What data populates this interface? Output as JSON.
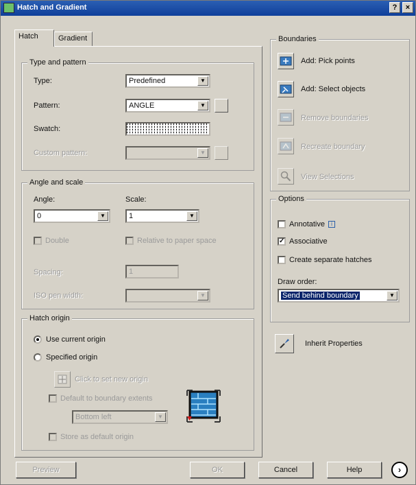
{
  "window": {
    "title": "Hatch and Gradient",
    "help_glyph": "?",
    "close_glyph": "×"
  },
  "tabs": [
    {
      "label": "Hatch"
    },
    {
      "label": "Gradient"
    }
  ],
  "type_pattern": {
    "group_label": "Type and pattern",
    "type_label": "Type:",
    "type_value": "Predefined",
    "pattern_label": "Pattern:",
    "pattern_value": "ANGLE",
    "swatch_label": "Swatch:",
    "custom_label": "Custom pattern:"
  },
  "angle_scale": {
    "group_label": "Angle and scale",
    "angle_label": "Angle:",
    "angle_value": "0",
    "scale_label": "Scale:",
    "scale_value": "1",
    "double_label": "Double",
    "relative_label": "Relative to paper space",
    "spacing_label": "Spacing:",
    "spacing_value": "1",
    "iso_label": "ISO pen width:"
  },
  "origin": {
    "group_label": "Hatch origin",
    "use_current": "Use current origin",
    "specified": "Specified origin",
    "click_set": "Click to set new origin",
    "default_extents": "Default to boundary extents",
    "position_value": "Bottom left",
    "store_default": "Store as default origin"
  },
  "boundaries": {
    "group_label": "Boundaries",
    "add_pick": "Add: Pick points",
    "add_select": "Add: Select objects",
    "remove": "Remove boundaries",
    "recreate": "Recreate boundary",
    "view": "View Selections"
  },
  "options": {
    "group_label": "Options",
    "annotative": "Annotative",
    "associative": "Associative",
    "separate": "Create separate hatches",
    "draw_order_label": "Draw order:",
    "draw_order_value": "Send behind boundary"
  },
  "inherit": {
    "label": "Inherit Properties"
  },
  "footer": {
    "preview": "Preview",
    "ok": "OK",
    "cancel": "Cancel",
    "help": "Help",
    "more": "›"
  },
  "checks": {
    "associative": "✓"
  },
  "colors": {
    "title_bar": "#0f3f9a",
    "dialog_bg": "#d6d2c8",
    "selection": "#0a246a",
    "disabled_text": "#9a9a9a"
  }
}
